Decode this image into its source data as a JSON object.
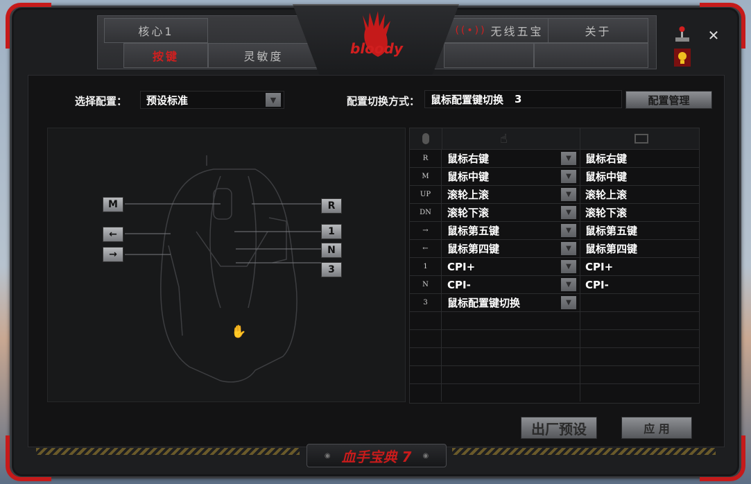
{
  "colors": {
    "accent": "#d11f1f",
    "panel": "#131314",
    "text": "#ffffff"
  },
  "tabs": {
    "core": "核心1",
    "keys": "按键",
    "sensitivity": "灵敏度",
    "wireless": "无线五宝",
    "about": "关于"
  },
  "brand": "bloody",
  "config": {
    "select_label": "选择配置：",
    "select_value": "预设标准",
    "switch_label": "配置切换方式：",
    "switch_value": "鼠标配置键切换",
    "switch_number": "3",
    "manage_button": "配置管理"
  },
  "mouse_labels": [
    "M",
    "R",
    "←",
    "→",
    "1",
    "N",
    "3"
  ],
  "table": {
    "rows": [
      {
        "key": "R",
        "action": "鼠标右键",
        "default": "鼠标右键"
      },
      {
        "key": "M",
        "action": "鼠标中键",
        "default": "鼠标中键"
      },
      {
        "key": "UP",
        "action": "滚轮上滚",
        "default": "滚轮上滚"
      },
      {
        "key": "DN",
        "action": "滚轮下滚",
        "default": "滚轮下滚"
      },
      {
        "key": "→",
        "action": "鼠标第五键",
        "default": "鼠标第五键"
      },
      {
        "key": "←",
        "action": "鼠标第四键",
        "default": "鼠标第四键"
      },
      {
        "key": "1",
        "action": "CPI+",
        "default": "CPI+"
      },
      {
        "key": "N",
        "action": "CPI-",
        "default": "CPI-"
      },
      {
        "key": "3",
        "action": "鼠标配置键切换",
        "default": ""
      }
    ]
  },
  "footer": {
    "factory_button": "出厂预设",
    "apply_button": "应 用",
    "badge": "血手宝典 7"
  },
  "icons": [
    "wireless-antenna-icon",
    "joystick-icon",
    "lightbulb-icon",
    "close-icon",
    "mouse-icon",
    "hand-pointer-icon",
    "monitor-icon",
    "dropdown-arrow-icon"
  ]
}
